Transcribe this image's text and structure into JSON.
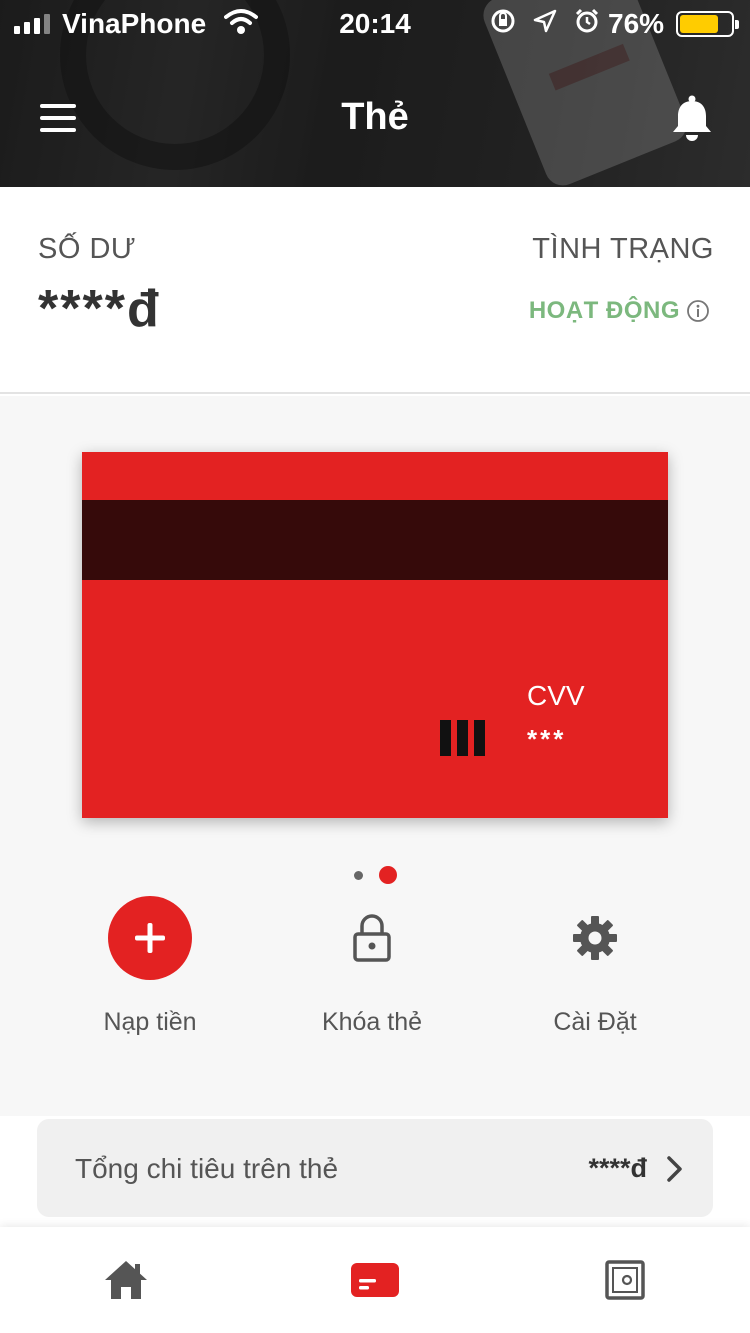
{
  "status_bar": {
    "carrier": "VinaPhone",
    "time": "20:14",
    "battery_percent": "76%",
    "battery_level": 0.76,
    "icons": [
      "orientation-lock-icon",
      "location-icon",
      "alarm-icon"
    ]
  },
  "header": {
    "title": "Thẻ",
    "menu_icon": "hamburger-menu-icon",
    "notification_icon": "bell-icon"
  },
  "balance": {
    "label": "SỐ DƯ",
    "value": "****đ"
  },
  "status": {
    "label": "TÌNH TRẠNG",
    "value": "HOẠT ĐỘNG",
    "color": "#7cb87e",
    "icon": "info-icon"
  },
  "card": {
    "color": "#e32222",
    "stripe_color": "#360a0a",
    "cvv_label": "CVV",
    "cvv_value": "***"
  },
  "pager": {
    "count": 2,
    "active_index": 1
  },
  "actions": [
    {
      "label": "Nạp tiền",
      "icon": "plus-icon"
    },
    {
      "label": "Khóa thẻ",
      "icon": "lock-icon"
    },
    {
      "label": "Cài Đặt",
      "icon": "gear-icon"
    }
  ],
  "spending": {
    "label": "Tổng chi tiêu trên thẻ",
    "value": "****đ",
    "icon": "chevron-right-icon"
  },
  "tab_bar": {
    "tabs": [
      {
        "icon": "home-icon",
        "active": false
      },
      {
        "icon": "card-icon",
        "active": true
      },
      {
        "icon": "wallet-icon",
        "active": false
      }
    ],
    "active_color": "#e32222",
    "inactive_color": "#555555"
  }
}
